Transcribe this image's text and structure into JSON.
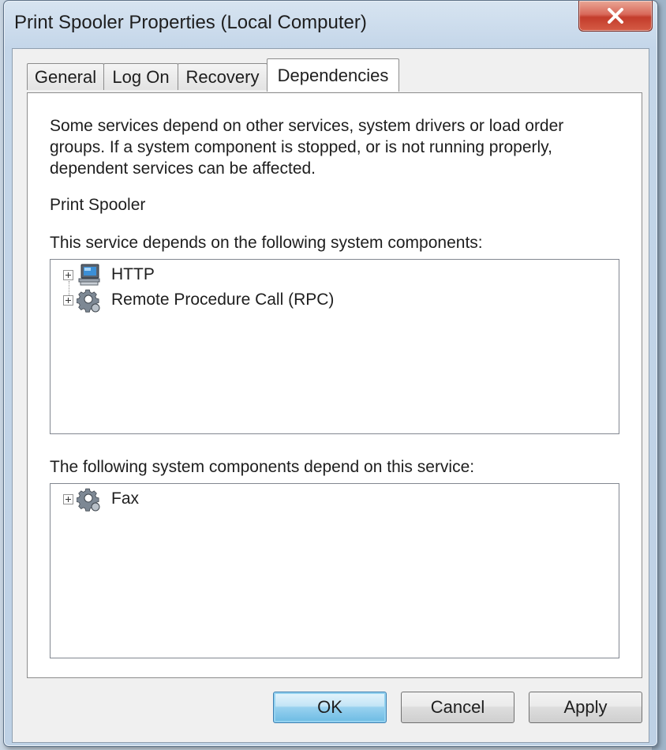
{
  "window": {
    "title": "Print Spooler Properties (Local Computer)",
    "close_symbol": "X"
  },
  "tabs": [
    {
      "label": "General",
      "active": false
    },
    {
      "label": "Log On",
      "active": false
    },
    {
      "label": "Recovery",
      "active": false
    },
    {
      "label": "Dependencies",
      "active": true
    }
  ],
  "panel": {
    "description": "Some services depend on other services, system drivers or load order groups. If a system component is stopped, or is not running properly, dependent services can be affected.",
    "service_name": "Print Spooler",
    "depends_on_label": "This service depends on the following system components:",
    "depends_on": [
      {
        "label": "HTTP",
        "icon": "computer-icon"
      },
      {
        "label": "Remote Procedure Call (RPC)",
        "icon": "gear-service-icon"
      }
    ],
    "depended_by_label": "The following system components depend on this service:",
    "depended_by": [
      {
        "label": "Fax",
        "icon": "gear-service-icon"
      }
    ]
  },
  "buttons": {
    "ok": "OK",
    "cancel": "Cancel",
    "apply": "Apply"
  }
}
